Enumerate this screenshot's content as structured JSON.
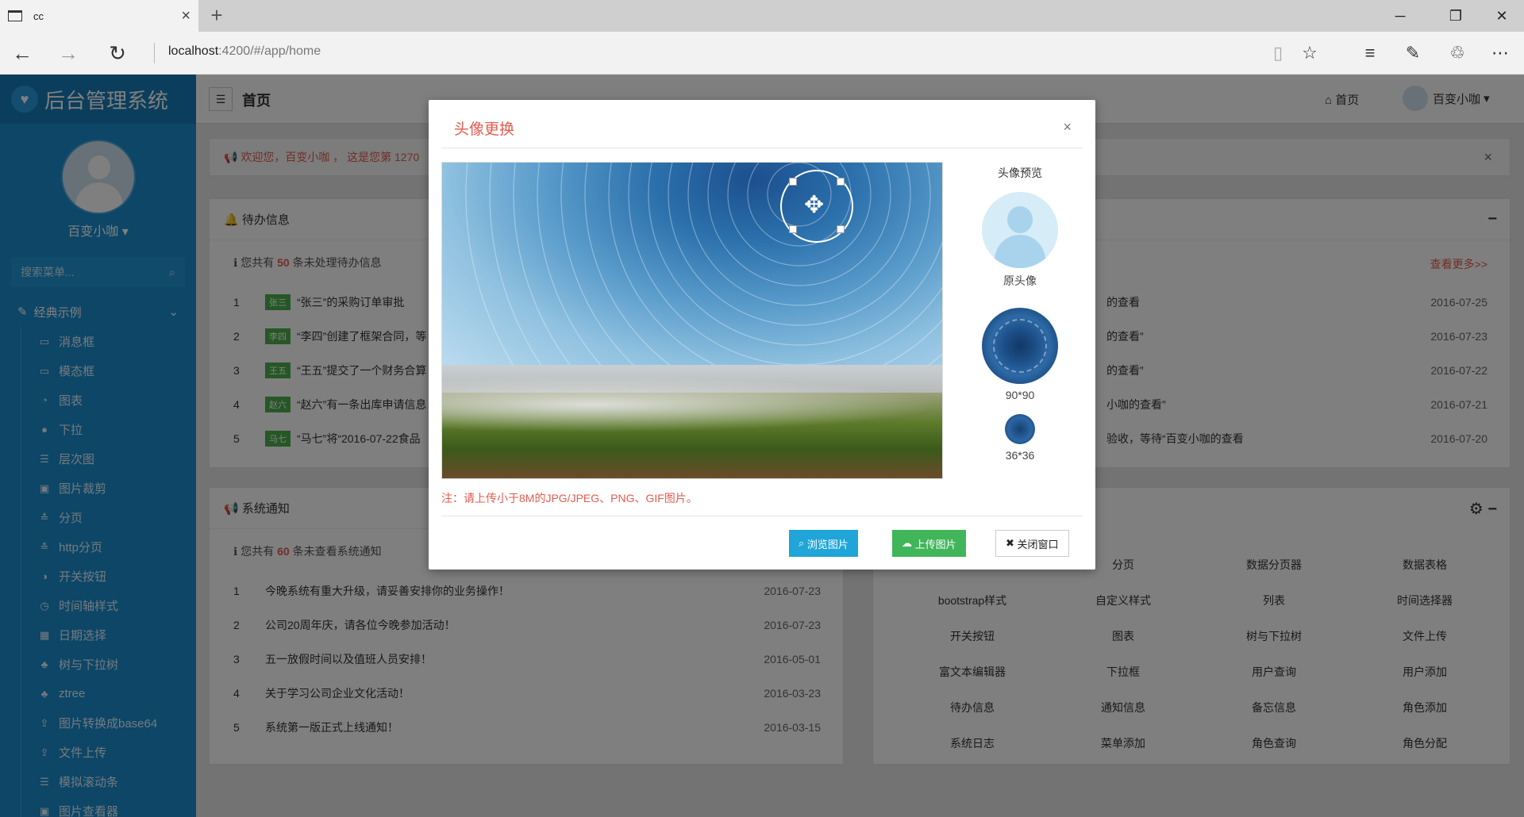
{
  "browser": {
    "tab_title": "cc",
    "url_host": "localhost",
    "url_rest": ":4200/#/app/home"
  },
  "app": {
    "brand": "后台管理系统",
    "user": "百变小咖",
    "search_placeholder": "搜索菜单...",
    "page_title": "首页",
    "home_link": "首页",
    "menu_group": "经典示例",
    "menu_items": [
      "消息框",
      "模态框",
      "图表",
      "下拉",
      "层次图",
      "图片裁剪",
      "分页",
      "http分页",
      "开关按钮",
      "时间轴样式",
      "日期选择",
      "树与下拉树",
      "ztree",
      "图片转换成base64",
      "文件上传",
      "模拟滚动条",
      "图片查看器"
    ],
    "welcome": "欢迎您，百变小咖 ， 这是您第 1270"
  },
  "todo_panel": {
    "title": "待办信息",
    "summary_prefix": "您共有",
    "summary_count": "50",
    "summary_suffix": "条未处理待办信息",
    "more": "查看更多>>",
    "rows": [
      {
        "num": "1",
        "badge": "张三",
        "text": "“张三”的采购订单审批",
        "tail": "",
        "date": "2016-07-25"
      },
      {
        "num": "2",
        "badge": "李四",
        "text": "“李四”创建了框架合同，等",
        "tail": "的查看”",
        "date": "2016-07-23"
      },
      {
        "num": "3",
        "badge": "王五",
        "text": "“王五”提交了一个财务合算",
        "tail": "的查看”",
        "date": "2016-07-22"
      },
      {
        "num": "4",
        "badge": "赵六",
        "text": "“赵六”有一条出库申请信息",
        "tail": "小咖的查看”",
        "date": "2016-07-21"
      },
      {
        "num": "5",
        "badge": "马七",
        "text": "“马七”将“2016-07-22食品",
        "tail": "验收，等待“百变小咖的查看",
        "date": "2016-07-20"
      }
    ],
    "row1_tail": "的查看"
  },
  "notice_panel": {
    "title": "系统通知",
    "summary_prefix": "您共有",
    "summary_count": "60",
    "summary_suffix": "条未查看系统通知",
    "rows": [
      {
        "num": "1",
        "text": "今晚系统有重大升级，请妥善安排你的业务操作！",
        "date": "2016-07-23"
      },
      {
        "num": "2",
        "text": "公司20周年庆，请各位今晚参加活动！",
        "date": "2016-07-23"
      },
      {
        "num": "3",
        "text": "五一放假时间以及值班人员安排！",
        "date": "2016-05-01"
      },
      {
        "num": "4",
        "text": "关于学习公司企业文化活动！",
        "date": "2016-03-23"
      },
      {
        "num": "5",
        "text": "系统第一版正式上线通知！",
        "date": "2016-03-15"
      }
    ]
  },
  "quick_links": [
    [
      "分页",
      "数据分页器",
      "数据表格"
    ],
    [
      "bootstrap样式",
      "自定义样式",
      "列表",
      "时间选择器"
    ],
    [
      "开关按钮",
      "图表",
      "树与下拉树",
      "文件上传"
    ],
    [
      "富文本编辑器",
      "下拉框",
      "用户查询",
      "用户添加"
    ],
    [
      "待办信息",
      "通知信息",
      "备忘信息",
      "角色添加"
    ],
    [
      "系统日志",
      "菜单添加",
      "角色查询",
      "角色分配"
    ]
  ],
  "modal": {
    "title": "头像更换",
    "preview_title": "头像预览",
    "original_label": "原头像",
    "size_big": "90*90",
    "size_small": "36*36",
    "note": "注：请上传小于8M的JPG/JPEG、PNG、GIF图片。",
    "btn_browse": "浏览图片",
    "btn_upload": "上传图片",
    "btn_close": "关闭窗口"
  }
}
